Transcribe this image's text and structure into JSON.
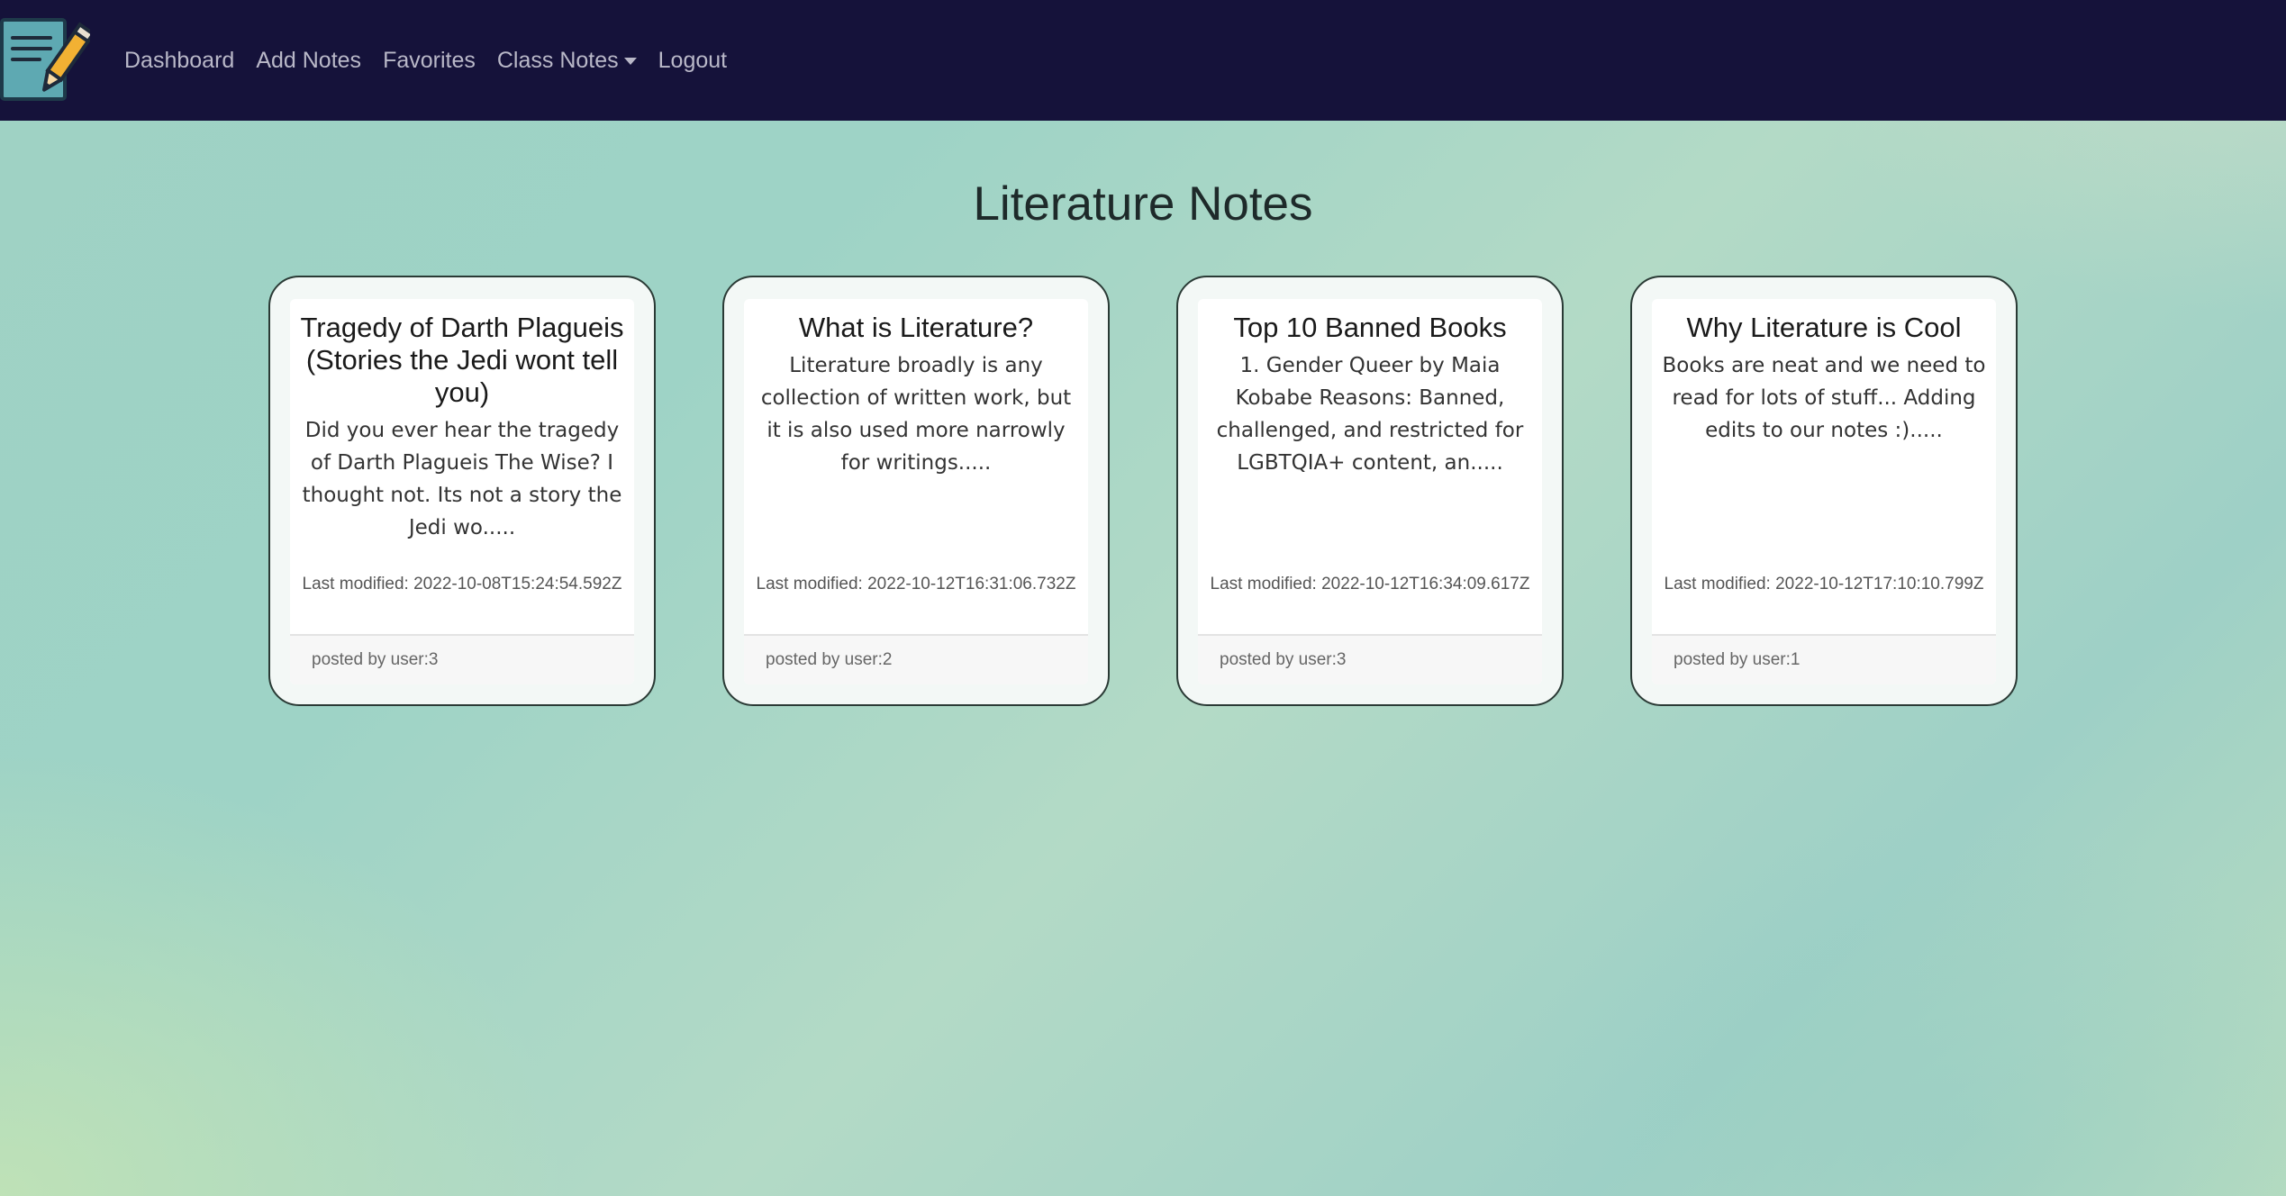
{
  "nav": {
    "items": [
      {
        "label": "Dashboard"
      },
      {
        "label": "Add Notes"
      },
      {
        "label": "Favorites"
      },
      {
        "label": "Class Notes"
      },
      {
        "label": "Logout"
      }
    ]
  },
  "page": {
    "title": "Literature Notes"
  },
  "cards": [
    {
      "title": "Tragedy of Darth Plagueis (Stories the Jedi wont tell you)",
      "excerpt": "Did you ever hear the tragedy of Darth Plagueis The Wise? I thought not. Its not a story the Jedi wo.....",
      "modified": "Last modified: 2022-10-08T15:24:54.592Z",
      "author": "posted by user:3"
    },
    {
      "title": "What is Literature?",
      "excerpt": "Literature broadly is any collection of written work, but it is also used more narrowly for writings.....",
      "modified": "Last modified: 2022-10-12T16:31:06.732Z",
      "author": "posted by user:2"
    },
    {
      "title": "Top 10 Banned Books",
      "excerpt": "1. Gender Queer by Maia Kobabe Reasons: Banned, challenged, and restricted for LGBTQIA+ content, an.....",
      "modified": "Last modified: 2022-10-12T16:34:09.617Z",
      "author": "posted by user:3"
    },
    {
      "title": "Why Literature is Cool",
      "excerpt": "Books are neat and we need to read for lots of stuff... Adding edits to our notes :).....",
      "modified": "Last modified: 2022-10-12T17:10:10.799Z",
      "author": "posted by user:1"
    }
  ],
  "colors": {
    "navbar": "#15123a",
    "nav_text": "#b9b8c8",
    "logo_bg": "#5ea9b2",
    "pencil": "#f2b133"
  },
  "icons": {
    "logo": "notepad-pencil-icon",
    "dropdown": "caret-down-icon"
  }
}
